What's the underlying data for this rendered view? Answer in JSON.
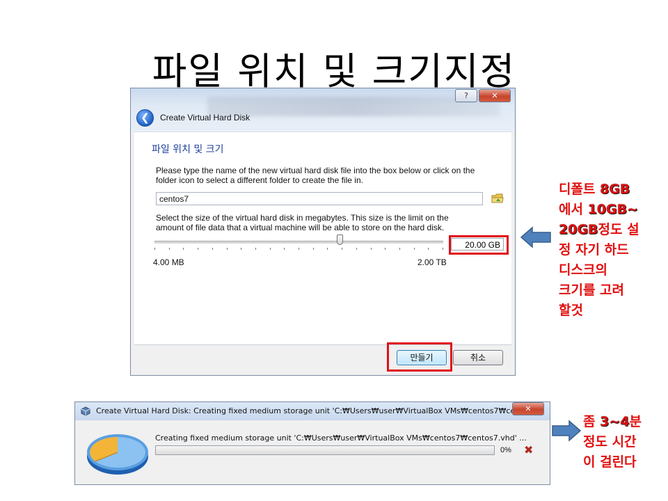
{
  "slide": {
    "title": "파일 위치 및 크기지정"
  },
  "dialog1": {
    "help_label": "?",
    "close_label": "✕",
    "back_label": "❮",
    "title": "Create Virtual Hard Disk",
    "heading": "파일 위치 및 크기",
    "instruction_name_line1": "Please type the name of the new virtual hard disk file into the box below or click on the",
    "instruction_name_line2": "folder icon to select a different folder to create the file in.",
    "file_name_value": "centos7",
    "instruction_size_line1": "Select the size of the virtual hard disk in megabytes. This size is the limit on the",
    "instruction_size_line2": "amount of file data that a virtual machine will be able to store on the hard disk.",
    "size_value": "20.00 GB",
    "slider_position_fraction": 0.64,
    "range_min": "4.00 MB",
    "range_max": "2.00 TB",
    "create_button": "만들기",
    "cancel_button": "취소"
  },
  "annotation_size": {
    "line1_a": "디폴트 ",
    "line1_b": "8GB",
    "line2_a": "에서 ",
    "line2_b": "10GB~",
    "line3_a": "20GB",
    "line3_b": "정도 설",
    "line4": "정 자기 하드",
    "line5": "디스크의",
    "line6": "크기를 고려",
    "line7": "할것"
  },
  "dialog2": {
    "title": "Create Virtual Hard Disk: Creating fixed medium storage unit 'C:₩Users₩user₩VirtualBox VMs₩centos7₩cent...",
    "close_label": "✕",
    "operation_text": "Creating fixed medium storage unit 'C:₩Users₩user₩VirtualBox VMs₩centos7₩centos7.vhd' ...",
    "progress_percent": 0,
    "progress_label": "0%",
    "cancel_icon": "✖"
  },
  "annotation_time": {
    "line1_a": "좀 ",
    "line1_b": "3~4",
    "line1_c": "분",
    "line2": "정도 시간",
    "line3": "이 걸린다"
  },
  "colors": {
    "annotation_red": "#e11010",
    "arrow_blue": "#4f81bd",
    "progress_green": "#3fb13f"
  }
}
